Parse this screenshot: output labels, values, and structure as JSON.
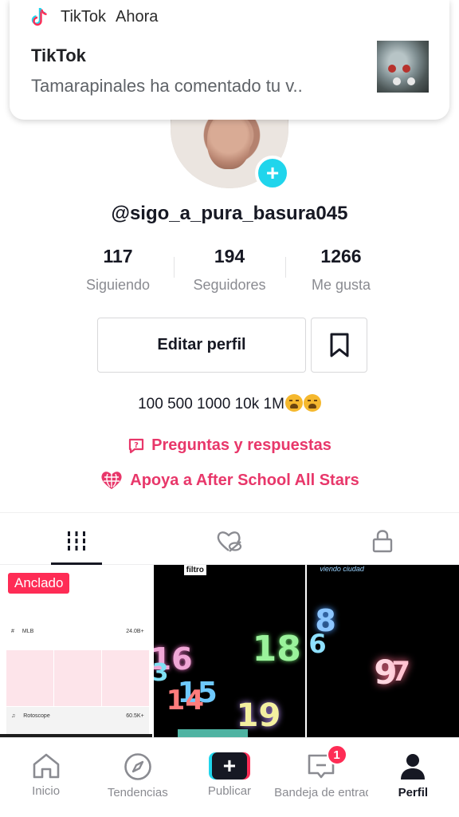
{
  "notification": {
    "app_name": "TikTok",
    "time": "Ahora",
    "title": "TikTok",
    "body": "Tamarapinales ha comentado tu v.."
  },
  "profile": {
    "username": "@sigo_a_pura_basura045",
    "stats": [
      {
        "value": "117",
        "label": "Siguiendo"
      },
      {
        "value": "194",
        "label": "Seguidores"
      },
      {
        "value": "1266",
        "label": "Me gusta"
      }
    ],
    "edit_button": "Editar perfil",
    "bio": "100 500 1000 10k 1M",
    "links": {
      "qa": "Preguntas y respuestas",
      "support": "Apoya a After School All Stars"
    }
  },
  "tabs": [
    "videos-grid-icon",
    "liked-hidden-icon",
    "lock-icon"
  ],
  "videos": [
    {
      "pinned_label": "Anclado",
      "rows": [
        {
          "name": "MLB",
          "value": "24.0B+"
        },
        {
          "name": "Rotoscope",
          "value": "60.5K+"
        }
      ]
    },
    {
      "tag": "filtro",
      "numbers": [
        "16",
        "3",
        "18",
        "15",
        "14",
        "19"
      ]
    },
    {
      "caption": "viendo ciudad",
      "numbers": [
        "8",
        "6",
        "9",
        "7"
      ]
    }
  ],
  "bottom_nav": [
    {
      "label": "Inicio",
      "icon": "home-icon"
    },
    {
      "label": "Tendencias",
      "icon": "compass-icon"
    },
    {
      "label": "Publicar",
      "icon": "plus-icon"
    },
    {
      "label": "Bandeja de entrada",
      "icon": "inbox-icon",
      "badge": "1"
    },
    {
      "label": "Perfil",
      "icon": "profile-icon",
      "active": true
    }
  ],
  "colors": {
    "accent": "#fe2c55",
    "link": "#e8376a",
    "cyan": "#20d5ec",
    "text": "#161823",
    "muted": "#8a8b91"
  }
}
